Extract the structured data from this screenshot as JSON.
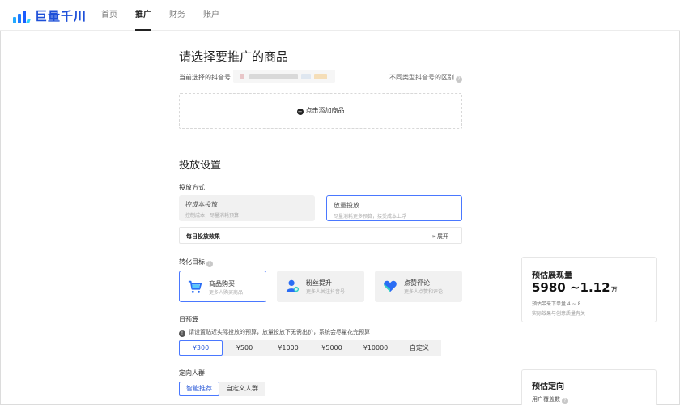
{
  "header": {
    "logo_text": "巨量千川",
    "nav": [
      "首页",
      "推广",
      "财务",
      "账户"
    ],
    "active_nav": "推广"
  },
  "product": {
    "title": "请选择要推广的商品",
    "account_label": "当前选择的抖音号",
    "diff_link": "不同类型抖音号的区别",
    "add_button": "点击添加商品"
  },
  "settings": {
    "title": "投放设置",
    "mode_label": "投放方式",
    "modes": [
      {
        "title": "控成本投放",
        "desc": "控制成本，尽量消耗预算"
      },
      {
        "title": "放量投放",
        "desc": "尽量消耗更多预算，接受成本上浮"
      }
    ],
    "selected_mode": "放量投放",
    "daily_effect": "每日投放效果",
    "expand": "展开",
    "goal_label": "转化目标",
    "goals": [
      {
        "title": "商品购买",
        "desc": "更多人购买商品",
        "icon": "cart-icon"
      },
      {
        "title": "粉丝提升",
        "desc": "更多人关注抖音号",
        "icon": "user-plus-icon"
      },
      {
        "title": "点赞评论",
        "desc": "更多人点赞和评论",
        "icon": "heart-icon"
      }
    ],
    "selected_goal": "商品购买",
    "budget_label": "日预算",
    "budget_notice": "请设置贴近实际投放的预算，放量投放下无需出价，系统会尽量花完预算",
    "budgets": [
      "¥300",
      "¥500",
      "¥1000",
      "¥5000",
      "¥10000",
      "自定义"
    ],
    "selected_budget": "¥300",
    "crowd_label": "定向人群",
    "crowd_options": [
      "智能推荐",
      "自定义人群"
    ],
    "selected_crowd": "智能推荐"
  },
  "estimate": {
    "title": "预估展现量",
    "value": "5980 ~1.12",
    "unit": "万",
    "orders": "预估带来下单量 4 ~ 8",
    "note": "实际效果与创意质量有关"
  },
  "targeting": {
    "title": "预估定向",
    "coverage": "用户覆盖数"
  },
  "colors": {
    "accent": "#4a78ff",
    "logo": "#1d4fd8"
  }
}
